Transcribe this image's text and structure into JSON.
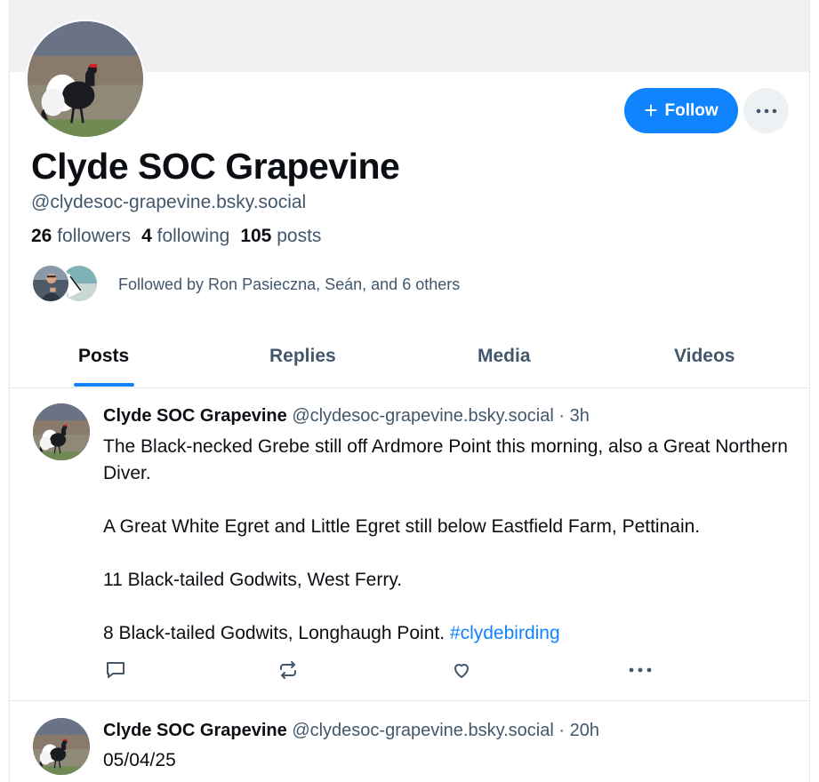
{
  "profile": {
    "display_name": "Clyde SOC Grapevine",
    "handle": "@clydesoc-grapevine.bsky.social",
    "followers_count": "26",
    "followers_label": "followers",
    "following_count": "4",
    "following_label": "following",
    "posts_count": "105",
    "posts_label": "posts",
    "followed_by": "Followed by Ron Pasieczna, Seán, and 6 others"
  },
  "actions": {
    "follow_label": "Follow",
    "follow_icon": "plus-icon",
    "more_icon": "ellipsis-icon"
  },
  "tabs": [
    {
      "label": "Posts",
      "active": true
    },
    {
      "label": "Replies",
      "active": false
    },
    {
      "label": "Media",
      "active": false
    },
    {
      "label": "Videos",
      "active": false
    }
  ],
  "posts": [
    {
      "author": "Clyde SOC Grapevine",
      "meta": "@clydesoc-grapevine.bsky.social · 3h",
      "paragraphs": [
        "The Black-necked Grebe still off Ardmore Point this morning, also a Great Northern Diver.",
        "A Great White Egret and Little Egret still below Eastfield Farm, Pettinain.",
        "11 Black-tailed Godwits, West Ferry.",
        "8 Black-tailed Godwits, Longhaugh Point. "
      ],
      "hashtag": "#clydebirding",
      "action_icons": [
        "reply-icon",
        "repost-icon",
        "like-icon",
        "ellipsis-icon"
      ]
    },
    {
      "author": "Clyde SOC Grapevine",
      "meta": "@clydesoc-grapevine.bsky.social · 20h",
      "paragraphs": [
        "05/04/25"
      ]
    }
  ],
  "colors": {
    "accent": "#1083fe",
    "text_primary": "#0b0f14",
    "text_secondary": "#42576c",
    "border": "#e3e8ee",
    "banner": "#f0f1f3"
  }
}
